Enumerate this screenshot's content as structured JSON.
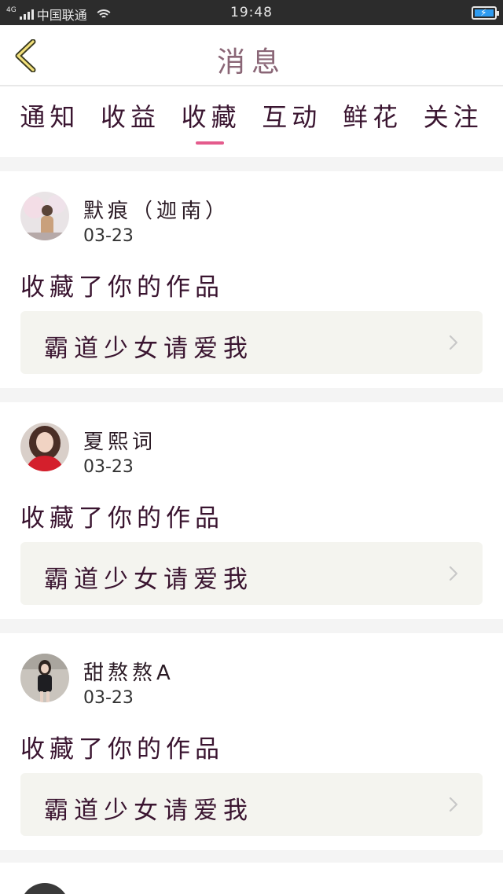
{
  "status_bar": {
    "network": "4G",
    "carrier": "中国联通",
    "time": "19:48",
    "icons": [
      "signal-icon",
      "wifi-icon",
      "battery-charging-icon"
    ]
  },
  "header": {
    "title": "消息",
    "back_icon": "chevron-left-icon"
  },
  "tabs": [
    {
      "label": "通知",
      "active": false
    },
    {
      "label": "收益",
      "active": false
    },
    {
      "label": "收藏",
      "active": true
    },
    {
      "label": "互动",
      "active": false
    },
    {
      "label": "鲜花",
      "active": false
    },
    {
      "label": "关注",
      "active": false
    }
  ],
  "colors": {
    "accent": "#e45b8c",
    "tab_text": "#3a1530",
    "card_bg": "#f4f4ef",
    "separator": "#f4f4f4"
  },
  "notifications": [
    {
      "user": "默痕（迦南）",
      "date": "03-23",
      "action": "收藏了你的作品",
      "work_title": "霸道少女请爱我",
      "avatar": "avatar-photo"
    },
    {
      "user": "夏熙词",
      "date": "03-23",
      "action": "收藏了你的作品",
      "work_title": "霸道少女请爱我",
      "avatar": "avatar-photo"
    },
    {
      "user": "甜熬熬A",
      "date": "03-23",
      "action": "收藏了你的作品",
      "work_title": "霸道少女请爱我",
      "avatar": "avatar-photo"
    }
  ]
}
